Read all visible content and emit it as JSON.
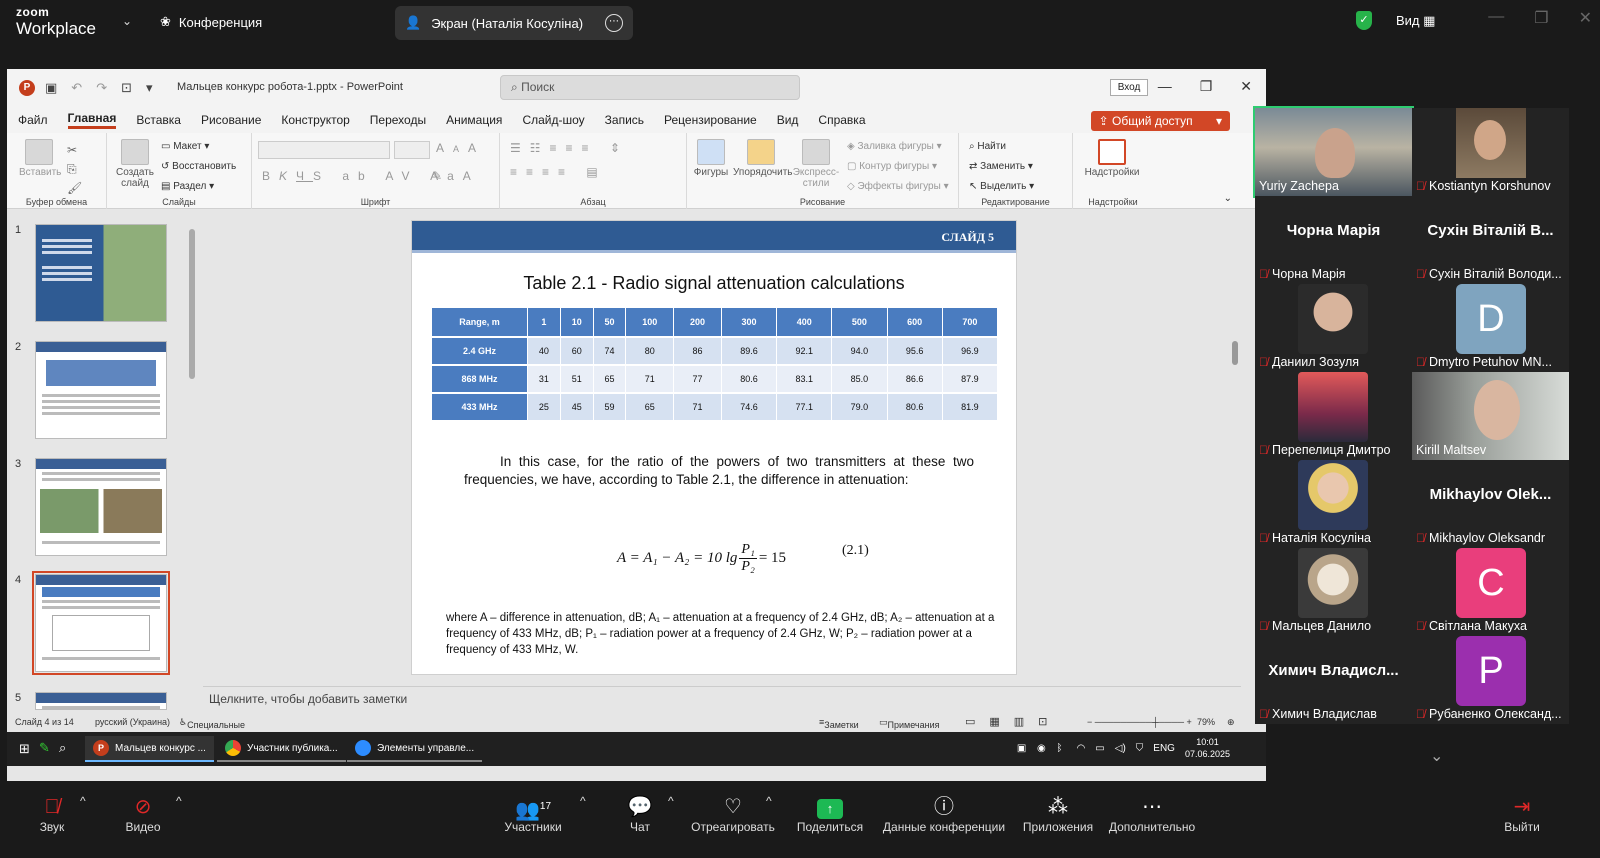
{
  "zoom": {
    "logo_line1": "zoom",
    "logo_line2": "Workplace",
    "meeting_label": "Конференция",
    "screen_share_label": "Экран (Наталія Косуліна)",
    "view_label": "Вид",
    "bottom": {
      "audio": "Звук",
      "video": "Видео",
      "participants": "Участники",
      "participants_count": "17",
      "chat": "Чат",
      "react": "Отреагировать",
      "share": "Поделиться",
      "meeting_info": "Данные конференции",
      "apps": "Приложения",
      "more": "Дополнительно",
      "leave": "Выйти"
    }
  },
  "ppt": {
    "filename": "Мальцев конкурс робота-1.pptx  -  PowerPoint",
    "search_placeholder": "Поиск",
    "signin": "Вход",
    "share": "Общий доступ",
    "tabs": [
      "Файл",
      "Главная",
      "Вставка",
      "Рисование",
      "Конструктор",
      "Переходы",
      "Анимация",
      "Слайд-шоу",
      "Запись",
      "Рецензирование",
      "Вид",
      "Справка"
    ],
    "ribbon": {
      "paste": "Вставить",
      "clipboard": "Буфер обмена",
      "new_slide": "Создать слайд",
      "layout": "Макет",
      "reset": "Восстановить",
      "section": "Раздел",
      "slides": "Слайды",
      "font": "Шрифт",
      "paragraph": "Абзац",
      "shapes": "Фигуры",
      "arrange": "Упорядочить",
      "express": "Экспресс-стили",
      "fill": "Заливка фигуры",
      "outline": "Контур фигуры",
      "effects": "Эффекты фигуры",
      "drawing": "Рисование",
      "find": "Найти",
      "replace": "Заменить",
      "select": "Выделить",
      "editing": "Редактирование",
      "addins_btn": "Надстройки",
      "addins": "Надстройки"
    },
    "thumb_nums": [
      "1",
      "2",
      "3",
      "4",
      "5"
    ],
    "notes_placeholder": "Щелкните, чтобы добавить заметки",
    "status": {
      "slide": "Слайд 4 из 14",
      "lang": "русский (Украина)",
      "access": "Специальные возможности: проверьте рекомендации",
      "notes": "Заметки",
      "comments": "Примечания",
      "zoom": "79%"
    }
  },
  "slide": {
    "header": "СЛАЙД 5",
    "title": "Table 2.1 - Radio signal attenuation calculations",
    "table": {
      "corner": "Range, m",
      "cols": [
        "1",
        "10",
        "50",
        "100",
        "200",
        "300",
        "400",
        "500",
        "600",
        "700"
      ],
      "rows": [
        {
          "label": "2.4 GHz",
          "values": [
            "40",
            "60",
            "74",
            "80",
            "86",
            "89.6",
            "92.1",
            "94.0",
            "95.6",
            "96.9"
          ]
        },
        {
          "label": "868 MHz",
          "values": [
            "31",
            "51",
            "65",
            "71",
            "77",
            "80.6",
            "83.1",
            "85.0",
            "86.6",
            "87.9"
          ]
        },
        {
          "label": "433 MHz",
          "values": [
            "25",
            "45",
            "59",
            "65",
            "71",
            "74.6",
            "77.1",
            "79.0",
            "80.6",
            "81.9"
          ]
        }
      ]
    },
    "paragraph": "In this case, for the ratio of the powers of two transmitters at these two frequencies, we have, according to Table 2.1, the difference in attenuation:",
    "formula_left": "A = A₁ − A₂ = 10 lg",
    "formula_num": "P₁",
    "formula_den": "P₂",
    "formula_right": "= 15",
    "eq_number": "(2.1)",
    "where_text": "where A – difference in attenuation, dB; A₁ – attenuation at a frequency of 2.4 GHz, dB; A₂ – attenuation at a frequency of 433 MHz, dB; P₁ – radiation power at a frequency of 2.4 GHz, W; P₂ – radiation power at a frequency of 433 MHz, W."
  },
  "taskbar": {
    "items": [
      "Мальцев конкурс ...",
      "Участник публика...",
      "Элементы управле..."
    ],
    "lang": "ENG",
    "time": "10:01",
    "date": "07.06.2025"
  },
  "participants": [
    {
      "name": "Yuriy Zachepa",
      "type": "video",
      "active": true
    },
    {
      "name": "Kostiantyn Korshunov",
      "type": "video"
    },
    {
      "name": "Чорна Марія",
      "big": "Чорна Марія",
      "type": "name"
    },
    {
      "name": "Сухін Віталій Володи...",
      "big": "Сухін Віталій В...",
      "type": "name"
    },
    {
      "name": "Даниил Зозуля",
      "type": "avatar"
    },
    {
      "name": "Dmytro Petuhov MN...",
      "letter": "D",
      "type": "letter"
    },
    {
      "name": "Перепелиця Дмитро",
      "type": "avatar"
    },
    {
      "name": "Kirill Maltsev",
      "type": "video"
    },
    {
      "name": "Наталія Косуліна",
      "type": "avatar"
    },
    {
      "name": "Mikhaylov Oleksandr",
      "big": "Mikhaylov  Olek...",
      "type": "name"
    },
    {
      "name": "Мальцев Данило",
      "type": "avatar"
    },
    {
      "name": "Світлана Макуха",
      "letter": "C",
      "type": "letter"
    },
    {
      "name": "Химич Владислав",
      "big": "Химич  Владисл...",
      "type": "name"
    },
    {
      "name": "Рубаненко Олександ...",
      "letter": "P",
      "type": "letter"
    }
  ],
  "colors": {
    "accent_ppt": "#d24726",
    "slide_header": "#2f5b93",
    "table_header": "#4a7cc0",
    "active_speaker": "#2ecc71",
    "mic_off": "#e02828"
  }
}
